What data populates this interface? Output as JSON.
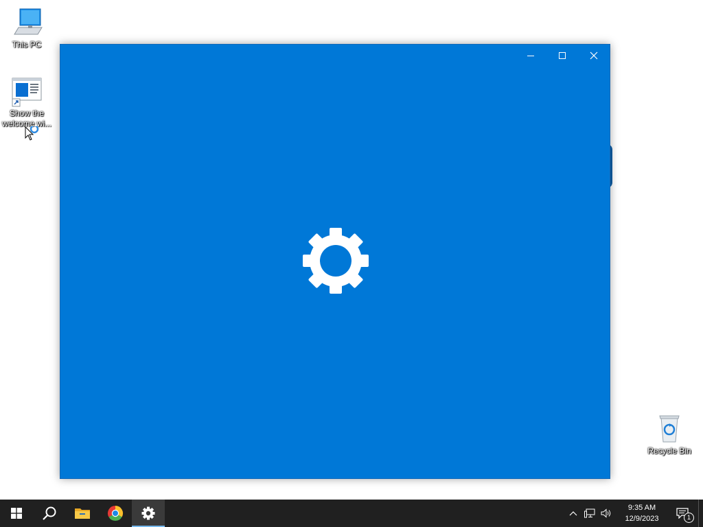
{
  "desktop": {
    "icons": [
      {
        "label": "This PC"
      },
      {
        "label": "Show the welcome wi..."
      },
      {
        "label": "Recycle Bin"
      }
    ]
  },
  "window": {
    "caption_buttons": {
      "minimize": "minimize-icon",
      "maximize": "maximize-icon",
      "close": "close-icon"
    },
    "splash_icon": "gear-icon",
    "background_color": "#0078d7"
  },
  "taskbar": {
    "background_color": "#202020",
    "items": [
      {
        "icon": "windows-start-icon"
      },
      {
        "icon": "search-icon"
      },
      {
        "icon": "file-explorer-icon"
      },
      {
        "icon": "chrome-icon"
      },
      {
        "icon": "settings-gear-icon",
        "active": true
      }
    ],
    "tray": {
      "icons": [
        "chevron-up-icon",
        "network-icon",
        "volume-icon"
      ],
      "time": "9:35 AM",
      "date": "12/9/2023",
      "notification_count": "1"
    }
  }
}
